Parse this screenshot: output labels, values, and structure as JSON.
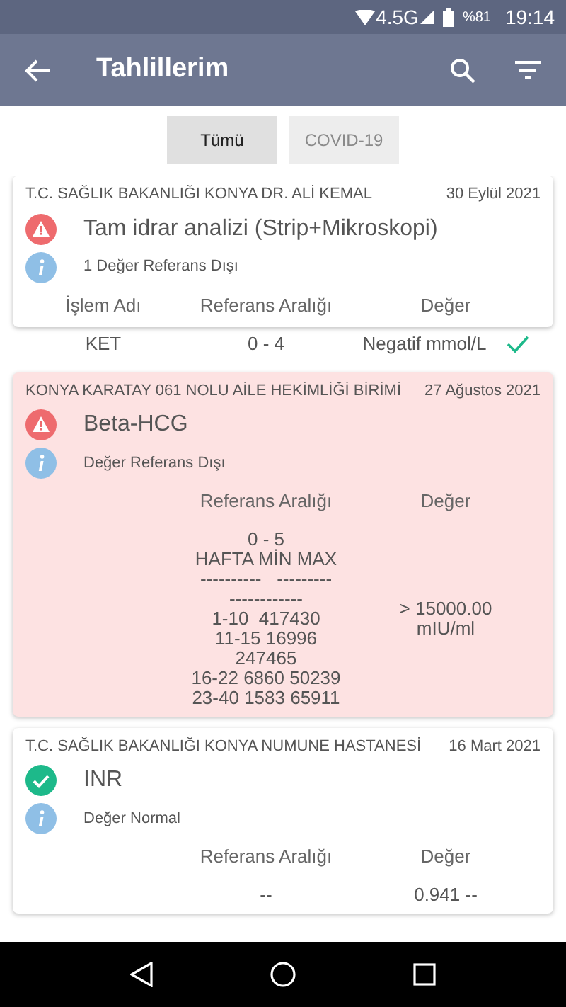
{
  "status_bar": {
    "network": "4.5G",
    "battery": "%81",
    "time": "19:14"
  },
  "app_bar": {
    "title": "Tahlillerim"
  },
  "tabs": [
    {
      "label": "Tümü",
      "selected": true
    },
    {
      "label": "COVID-19",
      "selected": false
    }
  ],
  "items": [
    {
      "kind": "card",
      "institution": "T.C. SAĞLIK BAKANLIĞI KONYA DR. ALİ KEMAL",
      "date": "30 Eylül 2021",
      "out_of_range": true,
      "highlighted": false,
      "test": "Tam idrar analizi (Strip+Mikroskopi)",
      "note": "1 Değer Referans Dışı",
      "columns": [
        "İşlem Adı",
        "Referans Aralığı",
        "Değer"
      ]
    },
    {
      "kind": "result_row",
      "name": "KET",
      "range": "0 - 4",
      "value": "Negatif mmol/L",
      "normal": true
    },
    {
      "kind": "card",
      "institution": "KONYA KARATAY 061 NOLU AİLE HEKİMLİĞİ BİRİMİ",
      "date": "27 Ağustos 2021",
      "out_of_range": true,
      "highlighted": true,
      "test": "Beta-HCG",
      "note": "Değer Referans Dışı",
      "columns": [
        "",
        "Referans Aralığı",
        "Değer"
      ],
      "rows": [
        {
          "name": "",
          "range": "0 - 5\nHAFTA MİN MAX\n----------   ---------\n------------\n1-10  417430\n11-15 16996\n247465\n16-22 6860 50239\n23-40 1583 65911",
          "value": "> 15000.00 mIU/ml"
        }
      ]
    },
    {
      "kind": "card",
      "institution": "T.C. SAĞLIK BAKANLIĞI KONYA NUMUNE HASTANESİ",
      "date": "16 Mart 2021",
      "out_of_range": false,
      "highlighted": false,
      "test": "INR",
      "note": "Değer Normal",
      "columns": [
        "",
        "Referans Aralığı",
        "Değer"
      ],
      "rows": [
        {
          "name": "",
          "range": "--",
          "value": "0.941 --"
        }
      ]
    }
  ]
}
